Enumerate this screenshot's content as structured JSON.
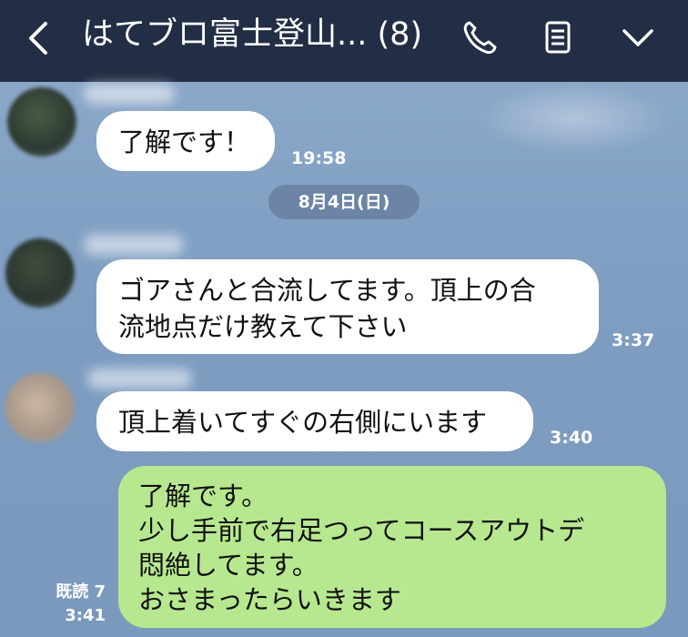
{
  "header": {
    "title": "はてブロ富士登山...",
    "member_count": "(8)",
    "back_icon": "chevron-left-icon",
    "call_icon": "phone-icon",
    "notes_icon": "notes-icon",
    "menu_icon": "chevron-down-icon"
  },
  "colors": {
    "header_bg": "#222e45",
    "chat_bg": "#7f9ec2",
    "incoming_bubble": "#ffffff",
    "outgoing_bubble": "#b7e88f"
  },
  "messages": [
    {
      "text": "了解です！",
      "time": "19:58"
    },
    {
      "lines": [
        "ゴアさんと合流してます。頂上の合",
        "流地点だけ教えて下さい"
      ],
      "time": "3:37"
    },
    {
      "text": "頂上着いてすぐの右側にいます",
      "time": "3:40"
    },
    {
      "lines": [
        "了解です。",
        "少し手前で右足つってコースアウトデ",
        "悶絶してます。",
        "おさまったらいきます"
      ],
      "time": "3:41",
      "read": "既読 7"
    }
  ],
  "date_divider": "8月4日(日)"
}
